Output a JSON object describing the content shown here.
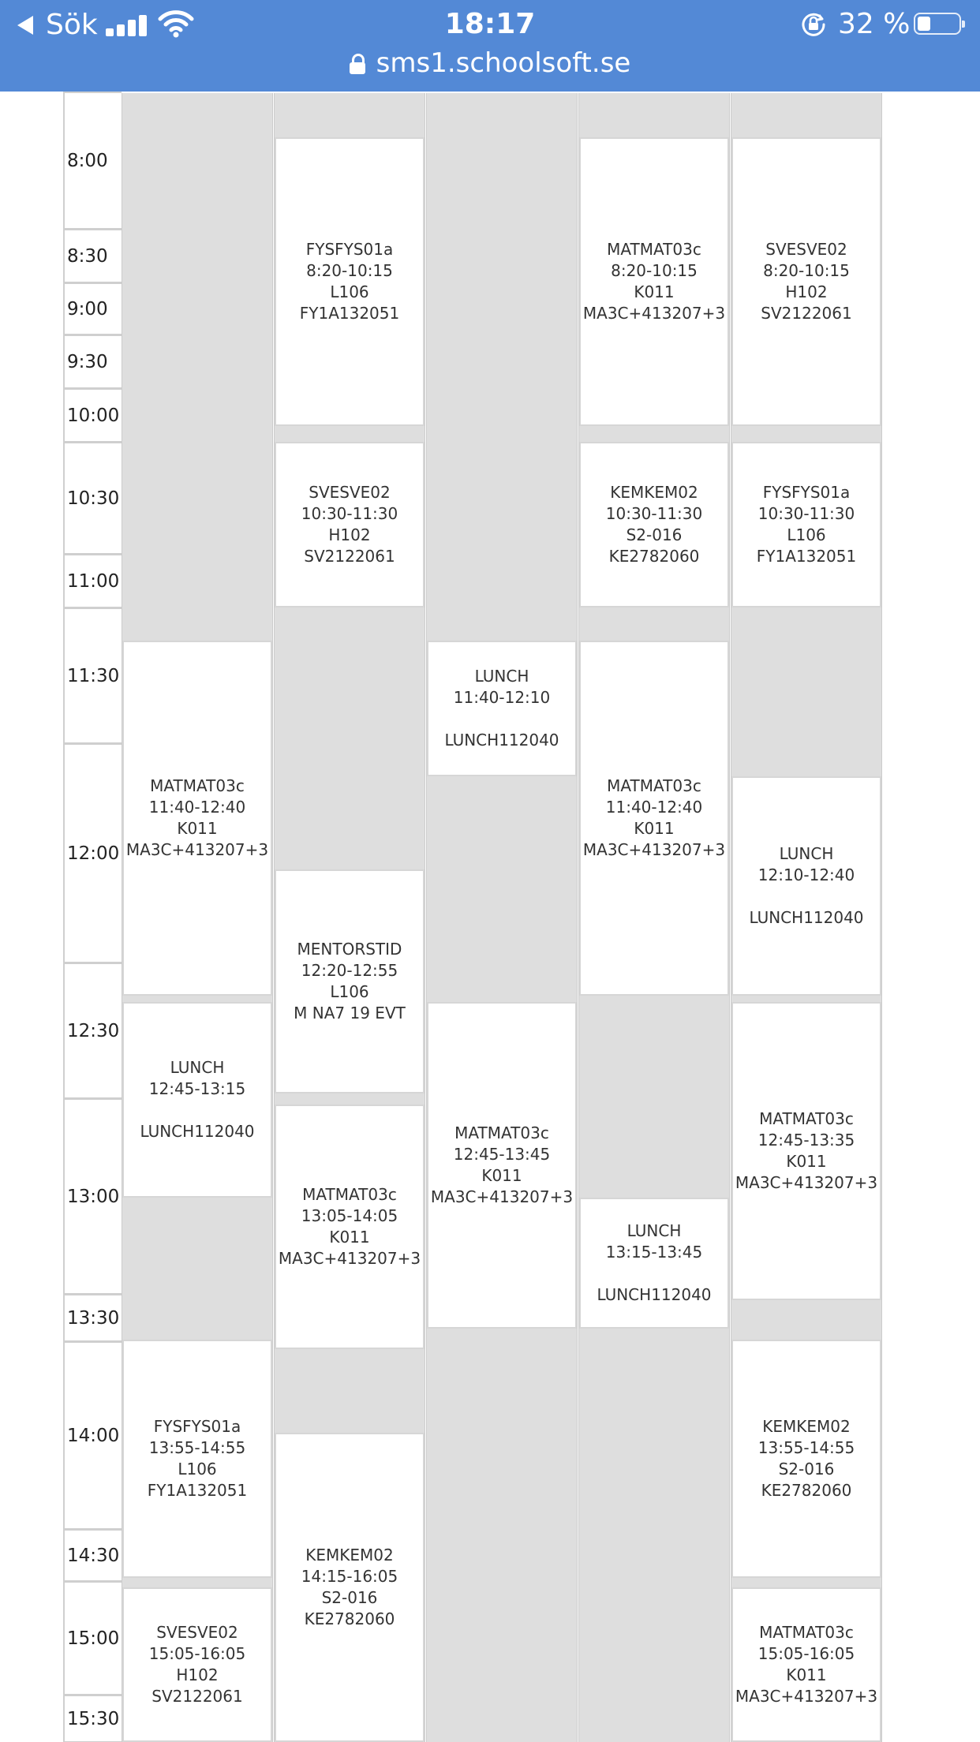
{
  "status_bar": {
    "back_label": "Sök",
    "time": "18:17",
    "battery_percent": "32 %",
    "battery_level": 0.32
  },
  "url_bar": {
    "url": "sms1.schoolsoft.se"
  },
  "time_labels": [
    "8:00",
    "8:30",
    "9:00",
    "9:30",
    "10:00",
    "10:30",
    "11:00",
    "11:30",
    "12:00",
    "12:30",
    "13:00",
    "13:30",
    "14:00",
    "14:30",
    "15:00",
    "15:30"
  ],
  "days": [
    {
      "lessons": [
        {
          "course": "MATMAT03c",
          "time": "11:40-12:40",
          "room": "K011",
          "group": "MA3C+413207+3"
        },
        {
          "course": "LUNCH",
          "time": "12:45-13:15",
          "room": "",
          "group": "LUNCH112040"
        },
        {
          "course": "FYSFYS01a",
          "time": "13:55-14:55",
          "room": "L106",
          "group": "FY1A132051"
        },
        {
          "course": "SVESVE02",
          "time": "15:05-16:05",
          "room": "H102",
          "group": "SV2122061"
        }
      ]
    },
    {
      "lessons": [
        {
          "course": "FYSFYS01a",
          "time": "8:20-10:15",
          "room": "L106",
          "group": "FY1A132051"
        },
        {
          "course": "SVESVE02",
          "time": "10:30-11:30",
          "room": "H102",
          "group": "SV2122061"
        },
        {
          "course": "MENTORSTID",
          "time": "12:20-12:55",
          "room": "L106",
          "group": "M NA7 19 EVT"
        },
        {
          "course": "MATMAT03c",
          "time": "13:05-14:05",
          "room": "K011",
          "group": "MA3C+413207+3"
        },
        {
          "course": "KEMKEM02",
          "time": "14:15-16:05",
          "room": "S2-016",
          "group": "KE2782060"
        }
      ]
    },
    {
      "lessons": [
        {
          "course": "LUNCH",
          "time": "11:40-12:10",
          "room": "",
          "group": "LUNCH112040"
        },
        {
          "course": "MATMAT03c",
          "time": "12:45-13:45",
          "room": "K011",
          "group": "MA3C+413207+3"
        }
      ]
    },
    {
      "lessons": [
        {
          "course": "MATMAT03c",
          "time": "8:20-10:15",
          "room": "K011",
          "group": "MA3C+413207+3"
        },
        {
          "course": "KEMKEM02",
          "time": "10:30-11:30",
          "room": "S2-016",
          "group": "KE2782060"
        },
        {
          "course": "MATMAT03c",
          "time": "11:40-12:40",
          "room": "K011",
          "group": "MA3C+413207+3"
        },
        {
          "course": "LUNCH",
          "time": "13:15-13:45",
          "room": "",
          "group": "LUNCH112040"
        }
      ]
    },
    {
      "lessons": [
        {
          "course": "SVESVE02",
          "time": "8:20-10:15",
          "room": "H102",
          "group": "SV2122061"
        },
        {
          "course": "FYSFYS01a",
          "time": "10:30-11:30",
          "room": "L106",
          "group": "FY1A132051"
        },
        {
          "course": "LUNCH",
          "time": "12:10-12:40",
          "room": "",
          "group": "LUNCH112040"
        },
        {
          "course": "MATMAT03c",
          "time": "12:45-13:35",
          "room": "K011",
          "group": "MA3C+413207+3"
        },
        {
          "course": "KEMKEM02",
          "time": "13:55-14:55",
          "room": "S2-016",
          "group": "KE2782060"
        },
        {
          "course": "MATMAT03c",
          "time": "15:05-16:05",
          "room": "K011",
          "group": "MA3C+413207+3"
        }
      ]
    }
  ],
  "colors": {
    "header_bg": "#5389d6",
    "free_time_bg": "#dedede",
    "lesson_bg": "#ffffff",
    "border": "#cfcfcf"
  }
}
